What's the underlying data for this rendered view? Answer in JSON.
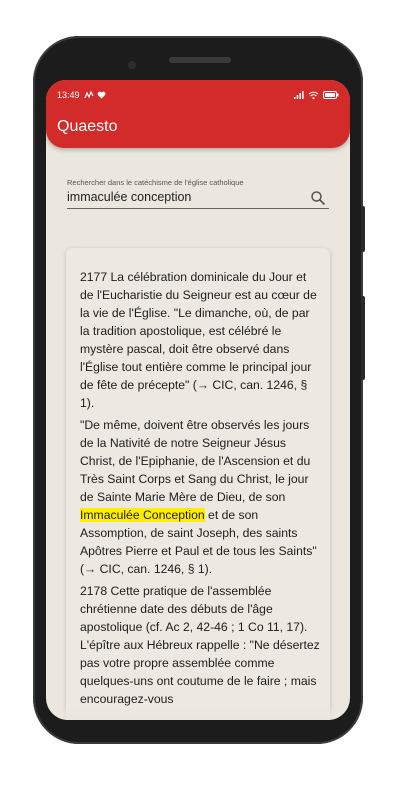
{
  "status_bar": {
    "time": "13:49"
  },
  "app": {
    "title": "Quaesto"
  },
  "search": {
    "label": "Rechercher dans le catéchisme de l'église catholique",
    "value": "immaculée conception"
  },
  "paragraphs": {
    "p1": "2177 La célébration dominicale du Jour et de l'Eucharistie du Seigneur est au cœur de la vie de l'Église. \"Le dimanche, où, de par la tradition apostolique, est célébré le mystère pascal, doit être observé dans l'Église tout entière comme le principal jour de fête de précepte\" (→ CIC, can. 1246, § 1).",
    "p2_before": "\"De même, doivent être observés les jours de la Nativité de notre Seigneur Jésus Christ, de l'Epiphanie, de l'Ascension et du Très Saint Corps et Sang du Christ, le jour de Sainte Marie Mère de Dieu, de son ",
    "p2_highlight": "Immaculée Conception",
    "p2_after": " et de son Assomption, de saint Joseph, des saints Apôtres Pierre et Paul et de tous les Saints\" (→ CIC, can. 1246, § 1).",
    "p3": "2178 Cette pratique de l'assemblée chrétienne date des débuts de l'âge apostolique (cf. Ac 2, 42-46 ; 1 Co 11, 17). L'épître aux Hébreux rappelle : \"Ne désertez pas votre propre assemblée comme quelques-uns ont coutume de le faire ; mais encouragez-vous"
  },
  "colors": {
    "app_bar": "#d32a2a",
    "background": "#ebe6de",
    "highlight": "#ffee00"
  },
  "icons": [
    "gesture-icon",
    "heart-icon",
    "signal-icon",
    "wifi-icon",
    "battery-icon",
    "search-icon"
  ]
}
